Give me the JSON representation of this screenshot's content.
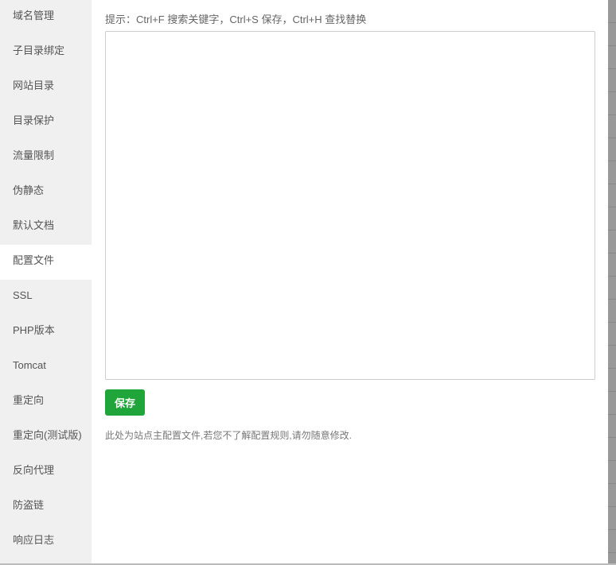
{
  "sidebar": {
    "items": [
      {
        "label": "域名管理"
      },
      {
        "label": "子目录绑定"
      },
      {
        "label": "网站目录"
      },
      {
        "label": "目录保护"
      },
      {
        "label": "流量限制"
      },
      {
        "label": "伪静态"
      },
      {
        "label": "默认文档"
      },
      {
        "label": "配置文件",
        "active": true
      },
      {
        "label": "SSL"
      },
      {
        "label": "PHP版本"
      },
      {
        "label": "Tomcat"
      },
      {
        "label": "重定向"
      },
      {
        "label": "重定向(测试版)"
      },
      {
        "label": "反向代理"
      },
      {
        "label": "防盗链"
      },
      {
        "label": "响应日志"
      }
    ]
  },
  "main": {
    "hint": "提示：Ctrl+F 搜索关键字，Ctrl+S 保存，Ctrl+H 查找替换",
    "editor_value": "",
    "save_label": "保存",
    "note": "此处为站点主配置文件,若您不了解配置规则,请勿随意修改."
  },
  "colors": {
    "accent": "#20a53a",
    "sidebar_bg": "#f0f0f0"
  }
}
